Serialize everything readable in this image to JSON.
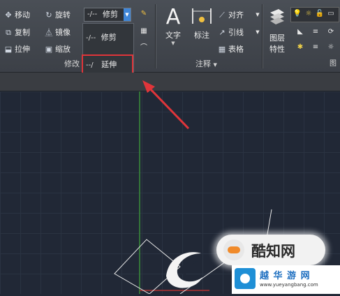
{
  "modify_panel": {
    "title": "修改",
    "tools": [
      {
        "label": "移动",
        "icon": "move-icon"
      },
      {
        "label": "复制",
        "icon": "copy-icon"
      },
      {
        "label": "拉伸",
        "icon": "stretch-icon"
      },
      {
        "label": "旋转",
        "icon": "rotate-icon"
      },
      {
        "label": "镜像",
        "icon": "mirror-icon"
      },
      {
        "label": "缩放",
        "icon": "scale-icon"
      }
    ],
    "dropdown": {
      "selected": "修剪",
      "options": [
        "修剪",
        "延伸"
      ],
      "highlighted": "延伸"
    }
  },
  "annotation_panel": {
    "title": "注释",
    "big_tools": [
      {
        "label": "文字",
        "icon": "text-A-icon"
      },
      {
        "label": "标注",
        "icon": "dimension-icon"
      }
    ],
    "tools": [
      {
        "label": "对齐",
        "icon": "align-icon"
      },
      {
        "label": "引线",
        "icon": "leader-icon"
      },
      {
        "label": "表格",
        "icon": "table-icon"
      }
    ]
  },
  "layers_panel": {
    "big_tool": {
      "label_line1": "图层",
      "label_line2": "特性",
      "icon": "layer-properties-icon"
    }
  },
  "watermark": {
    "brand": "酷知网",
    "site_line1": "越 华 游 网",
    "site_line2": "www.yueyangbang.com"
  },
  "colors": {
    "highlight_box": "#e0353a",
    "arrow": "#e0353a",
    "accent_blue": "#3f86d8",
    "canvas": "#212836"
  }
}
